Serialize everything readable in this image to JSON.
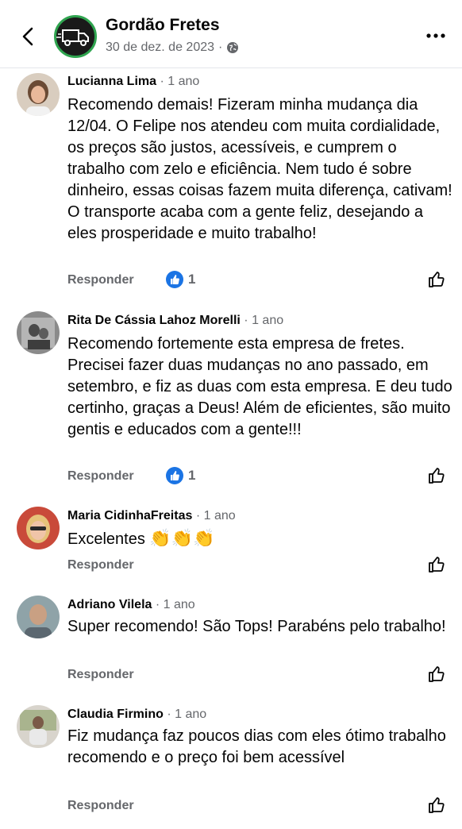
{
  "header": {
    "page_name": "Gordão Fretes",
    "date": "30 de dez. de 2023",
    "separator": "·"
  },
  "comments": [
    {
      "author": "Lucianna Lima",
      "time": "· 1 ano",
      "text": "Recomendo demais! Fizeram minha mudança dia 12/04. O Felipe nos atendeu com muita cordialidade, os preços são justos, acessíveis, e cumprem o trabalho com zelo e eficiência. Nem tudo é sobre dinheiro, essas coisas fazem muita diferença, cativam! O transporte acaba com a gente feliz, desejando a eles prosperidade e muito trabalho!",
      "reply_label": "Responder",
      "reaction_count": "1"
    },
    {
      "author": "Rita De Cássia Lahoz Morelli",
      "time": "· 1 ano",
      "text": "Recomendo fortemente esta empresa de fretes. Precisei fazer duas mudanças no ano passado, em setembro, e fiz as duas com esta empresa. E deu tudo certinho, graças a Deus! Além de eficientes, são muito gentis e educados com a gente!!!",
      "reply_label": "Responder",
      "reaction_count": "1"
    },
    {
      "author": "Maria CidinhaFreitas",
      "time": "· 1 ano",
      "text": "Excelentes",
      "emoji": "👏👏👏",
      "reply_label": "Responder"
    },
    {
      "author": "Adriano Vilela",
      "time": "· 1 ano",
      "text": "Super recomendo! São Tops! Parabéns pelo trabalho!",
      "reply_label": "Responder"
    },
    {
      "author": "Claudia Firmino",
      "time": "· 1 ano",
      "text": "Fiz mudança faz poucos dias com eles ótimo trabalho recomendo e o preço foi bem acessível",
      "reply_label": "Responder"
    }
  ],
  "colors": {
    "brand_green": "#2fa44f",
    "like_blue": "#1b74e4",
    "secondary_text": "#65676b"
  },
  "icons": [
    "back-arrow-icon",
    "truck-icon",
    "globe-icon",
    "more-options-icon",
    "like-reaction-icon",
    "thumbs-up-outline-icon"
  ]
}
